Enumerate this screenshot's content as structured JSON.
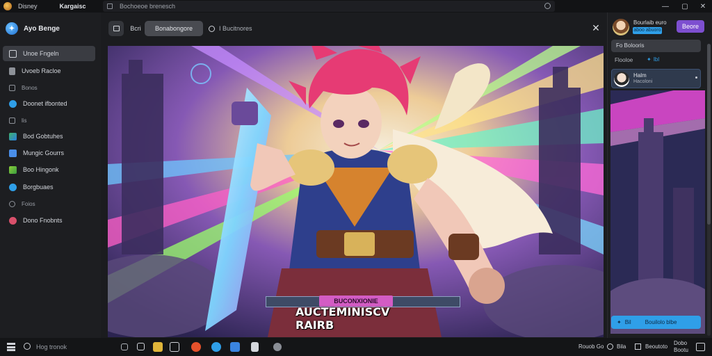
{
  "titlebar": {
    "app_name": "Disney",
    "menu_label": "Kargaisc",
    "address": "Bochoeoe brenesch",
    "window_controls": [
      "—",
      "▢",
      "✕"
    ]
  },
  "sidebar": {
    "brand": "Ayo Benge",
    "items": [
      {
        "label": "Unoe Fngeln",
        "icon": "image-icon",
        "active": true
      },
      {
        "label": "Uvoeb Racloe",
        "icon": "document-icon",
        "active": false
      },
      {
        "label": "Doonet ifbonted",
        "icon": "globe-icon",
        "active": false
      },
      {
        "label": "Bod Gobtuhes",
        "icon": "chart-icon",
        "active": false
      },
      {
        "label": "Mungic Gourrs",
        "icon": "grid-icon",
        "active": false
      },
      {
        "label": "Boo Hingonk",
        "icon": "check-icon",
        "active": false
      },
      {
        "label": "Borgbuaes",
        "icon": "circle-icon",
        "active": false
      },
      {
        "label": "Dono Fnobnts",
        "icon": "record-icon",
        "active": false
      }
    ],
    "headers": [
      "Bonos",
      "lis",
      "Foios"
    ]
  },
  "toolbar": {
    "back_label": "Bcri",
    "tab_active": "Bonabongore",
    "search_label": "I Bucitnores"
  },
  "viewer": {
    "banner_label": "BUCONXIONIE",
    "caption": "AUCTEMINISCV RAIRB"
  },
  "rightpanel": {
    "user_name": "Bourlaib euro",
    "user_badge": "aboo abuoro",
    "action_button": "Beore",
    "select_text": "Fo Bolooris",
    "filter_label": "Flooloe",
    "filter_tag": "Ibl",
    "card_name": "Halm",
    "card_sub": "Hacoloni",
    "cta_left": "Bil",
    "cta_right": "Bouilolo blbe"
  },
  "taskbar": {
    "search_text": "Hog tronok",
    "status_items": [
      "Rouob Go",
      "Bila",
      "Beoutoto"
    ],
    "clock_line1": "Dobo",
    "clock_line2": "Bootu"
  },
  "colors": {
    "accent_blue": "#2f9fe8",
    "accent_purple": "#7d4fd0",
    "banner_pink": "#d35cc4"
  }
}
